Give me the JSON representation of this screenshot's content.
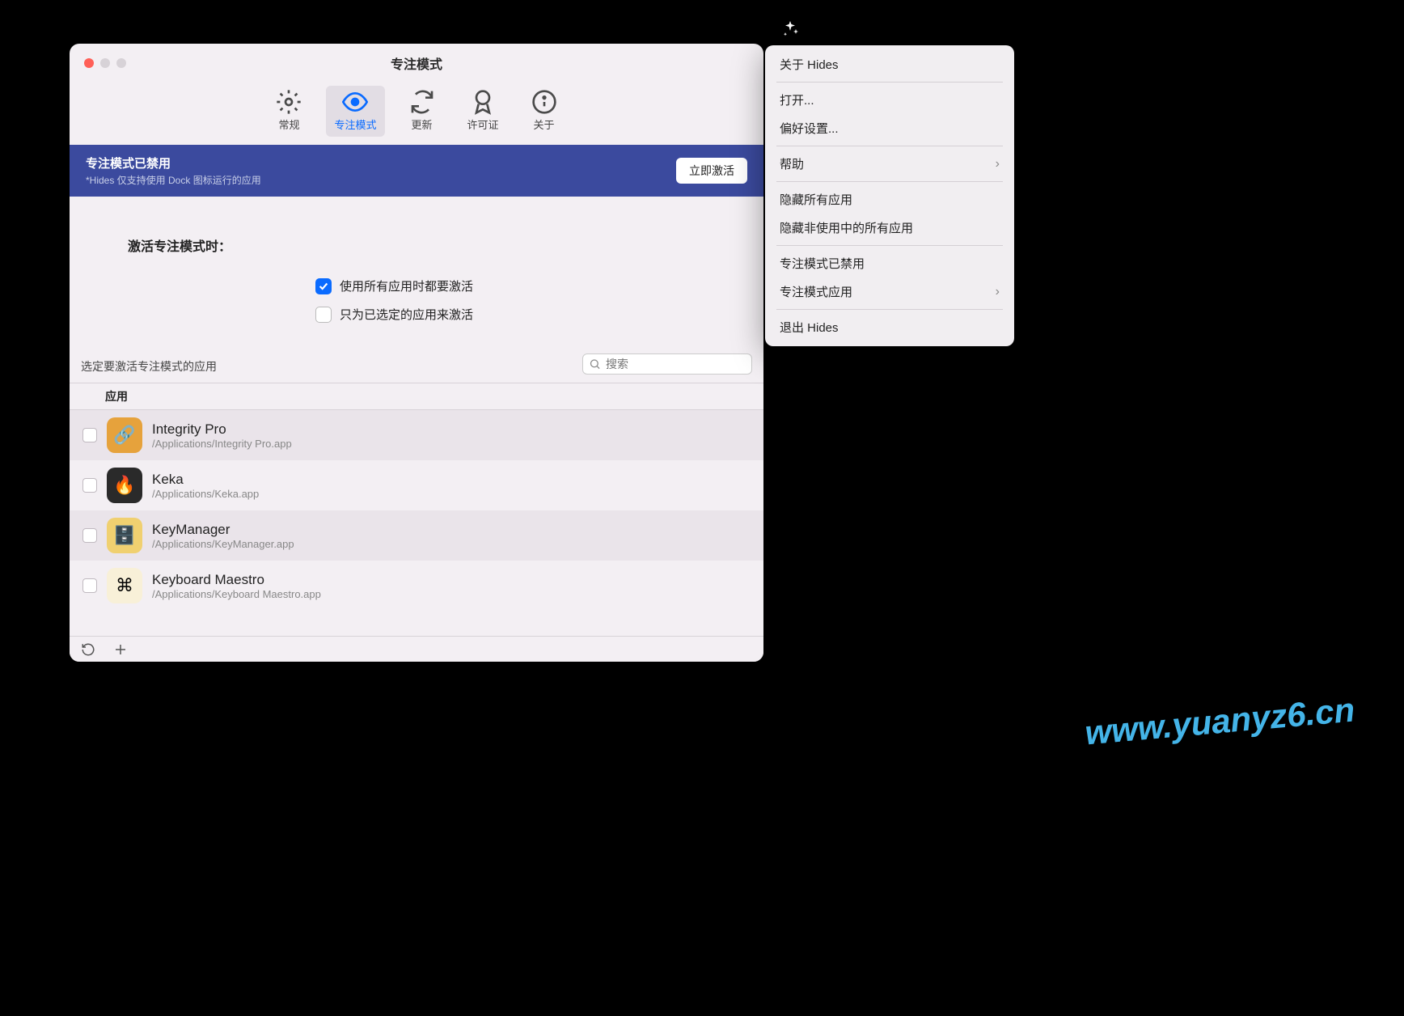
{
  "window": {
    "title": "专注模式",
    "traffic_colors": {
      "close": "#ff5f57",
      "inactive": "#d7d2d7"
    }
  },
  "toolbar": {
    "items": [
      {
        "label": "常规",
        "icon": "gear"
      },
      {
        "label": "专注模式",
        "icon": "eye",
        "selected": true
      },
      {
        "label": "更新",
        "icon": "refresh"
      },
      {
        "label": "许可证",
        "icon": "ribbon"
      },
      {
        "label": "关于",
        "icon": "info"
      }
    ]
  },
  "banner": {
    "title": "专注模式已禁用",
    "subtitle": "*Hides 仅支持使用 Dock 图标运行的应用",
    "button": "立即激活",
    "bg": "#3b4a9e"
  },
  "options": {
    "header": "激活专注模式时：",
    "opt1": {
      "label": "使用所有应用时都要激活",
      "checked": true
    },
    "opt2": {
      "label": "只为已选定的应用来激活",
      "checked": false
    }
  },
  "list_header": {
    "label": "选定要激活专注模式的应用",
    "search_placeholder": "搜索",
    "column": "应用"
  },
  "apps": [
    {
      "name": "Integrity Pro",
      "path": "/Applications/Integrity Pro.app",
      "icon_bg": "#e6a23c",
      "icon_emoji": "🔗",
      "alt": true
    },
    {
      "name": "Keka",
      "path": "/Applications/Keka.app",
      "icon_bg": "#2a2a2a",
      "icon_emoji": "🔥",
      "alt": false
    },
    {
      "name": "KeyManager",
      "path": "/Applications/KeyManager.app",
      "icon_bg": "#f0d070",
      "icon_emoji": "🗄️",
      "alt": true
    },
    {
      "name": "Keyboard Maestro",
      "path": "/Applications/Keyboard Maestro.app",
      "icon_bg": "#f8f0d8",
      "icon_emoji": "⌘",
      "alt": false
    }
  ],
  "menubar_icon": "sparkles",
  "popup": {
    "items": [
      {
        "label": "关于 Hides"
      },
      {
        "sep": true
      },
      {
        "label": "打开..."
      },
      {
        "label": "偏好设置..."
      },
      {
        "sep": true
      },
      {
        "label": "帮助",
        "chevron": true
      },
      {
        "sep": true
      },
      {
        "label": "隐藏所有应用"
      },
      {
        "label": "隐藏非使用中的所有应用"
      },
      {
        "sep": true
      },
      {
        "label": "专注模式已禁用"
      },
      {
        "label": "专注模式应用",
        "chevron": true
      },
      {
        "sep": true
      },
      {
        "label": "退出 Hides"
      }
    ]
  },
  "watermark": "www.yuanyz6.cn"
}
